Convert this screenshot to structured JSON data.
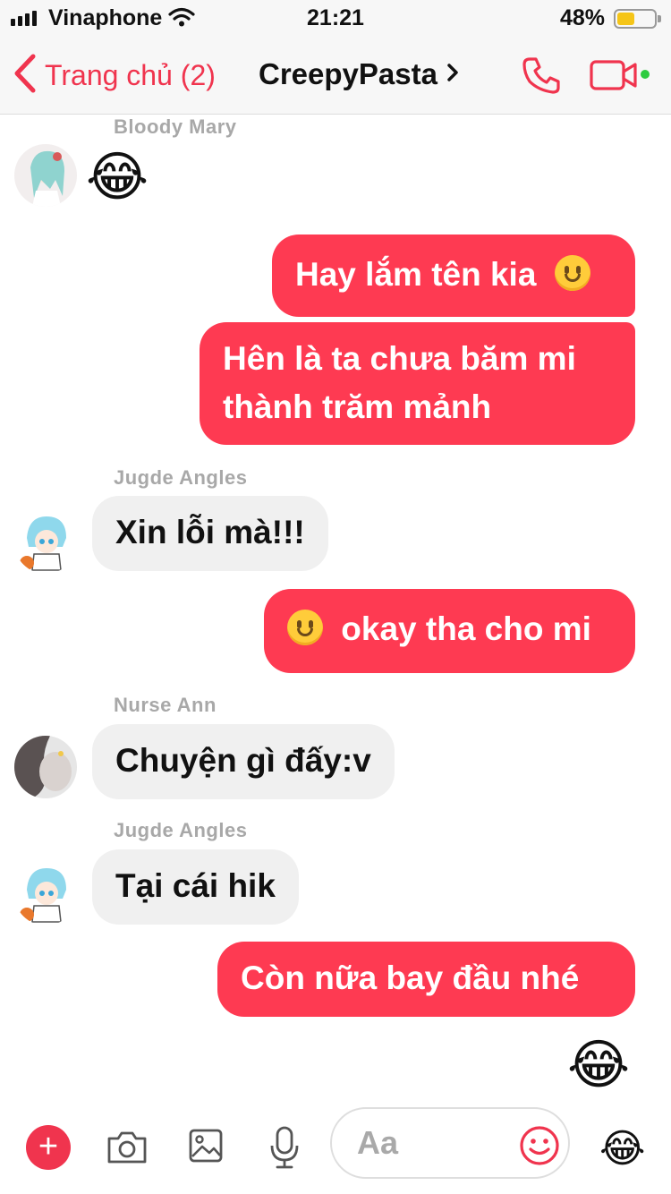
{
  "status_bar": {
    "carrier": "Vinaphone",
    "time": "21:21",
    "battery_percent": "48%",
    "battery_level": 0.48
  },
  "header": {
    "back_label": "Trang chủ (2)",
    "title": "CreepyPasta",
    "accent_color": "#f0344e",
    "online": true
  },
  "messages": [
    {
      "type": "incoming",
      "sender": "Bloody Mary",
      "emoji": "😂"
    },
    {
      "type": "outgoing",
      "text": "Hay lắm tên kia",
      "trailing_emoji": "slightly-smiling-face"
    },
    {
      "type": "outgoing",
      "line1": "Hên là ta chưa băm mi",
      "line2": "thành trăm mảnh"
    },
    {
      "type": "incoming",
      "sender": "Jugde Angles",
      "text": "Xin lỗi mà!!!"
    },
    {
      "type": "outgoing",
      "text": "okay tha cho mi",
      "leading_emoji": "slightly-smiling-face"
    },
    {
      "type": "incoming",
      "sender": "Nurse Ann",
      "text": "Chuyện gì đấy:v"
    },
    {
      "type": "incoming",
      "sender": "Jugde Angles",
      "text": "Tại cái hik"
    },
    {
      "type": "outgoing",
      "text": "Còn nữa bay đầu nhé"
    },
    {
      "type": "outgoing",
      "emoji": "😂"
    }
  ],
  "composer": {
    "placeholder": "Aa",
    "quick_reaction": "😂"
  },
  "colors": {
    "outgoing_bubble": "#fe3a52",
    "incoming_bubble": "#f0f0f0"
  }
}
